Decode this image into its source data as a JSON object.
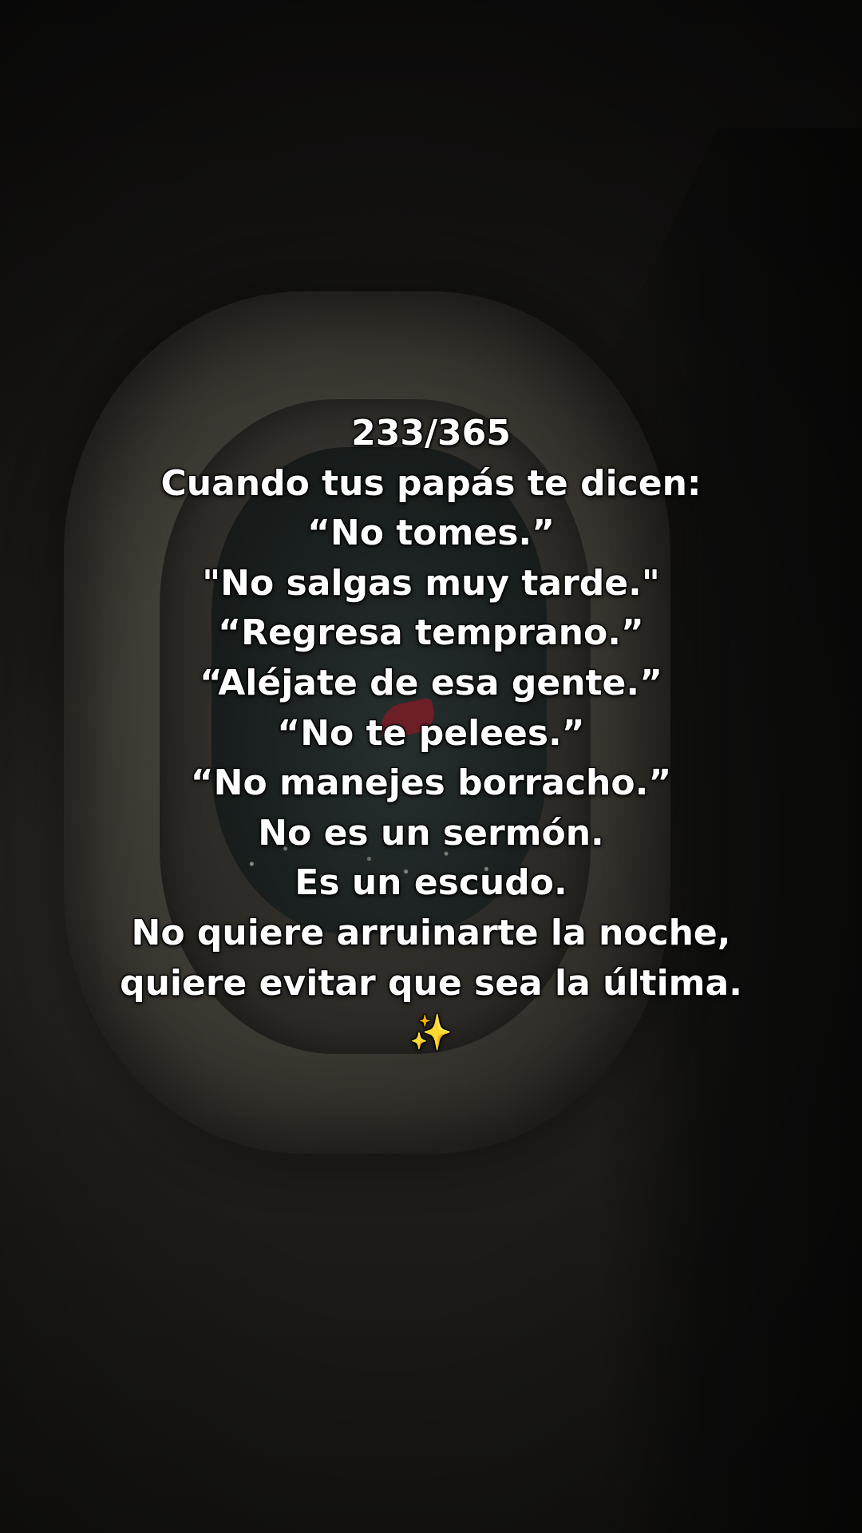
{
  "caption": {
    "lines": [
      "233/365",
      "Cuando tus papás te dicen:",
      "“No tomes.”",
      "\"No salgas muy tarde.\"",
      "“Regresa temprano.”",
      "“Aléjate de esa gente.”",
      "“No te pelees.”",
      "“No manejes borracho.”",
      "No es un sermón.",
      "Es un escudo.",
      "No quiere arruinarte la noche,",
      "quiere evitar que sea la última.",
      "✨"
    ]
  },
  "colors": {
    "caption_text": "#ffffff",
    "wingtip_red": "#7a1c27"
  },
  "icons": {
    "sparkles": "sparkles-emoji"
  }
}
